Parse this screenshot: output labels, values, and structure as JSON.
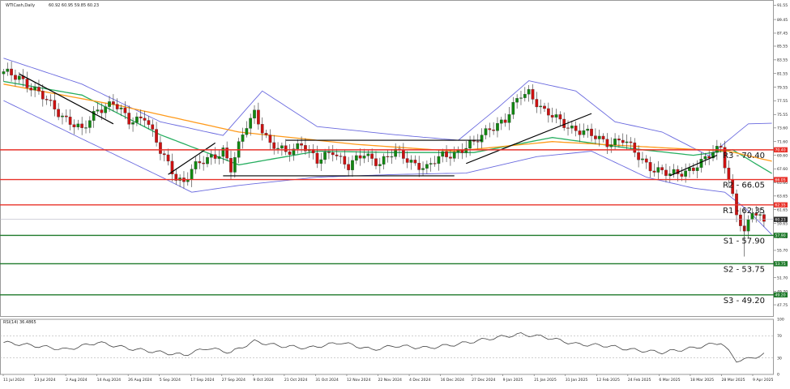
{
  "header": {
    "symbol": "WTICash,Daily",
    "ohlc": "60.92 60.95 59.85 60.23"
  },
  "colors": {
    "candle": "#cc1111",
    "candle_up": "#118811",
    "bollinger": "#6a6adf",
    "ma_fast": "#27ae60",
    "ma_slow": "#ff9a1a",
    "resistance": "#e8322a",
    "support": "#1f7a2b",
    "trendline": "#000000",
    "rsi": "#444444",
    "grid": "#c8c8c8"
  },
  "chart_data": [
    {
      "type": "line",
      "title": "WTICash,Daily",
      "ylim": [
        46.1,
        92.3
      ],
      "y_ticks": [
        "91.55",
        "89.45",
        "87.45",
        "85.55",
        "83.55",
        "81.55",
        "79.55",
        "77.55",
        "75.55",
        "73.60",
        "71.60",
        "69.60",
        "67.60",
        "65.60",
        "63.65",
        "61.65",
        "59.65",
        "57.65",
        "55.70",
        "53.70",
        "51.70",
        "49.70",
        "47.75"
      ],
      "x_labels": [
        "11 Jul 2024",
        "23 Jul 2024",
        "2 Aug 2024",
        "14 Aug 2024",
        "26 Aug 2024",
        "5 Sep 2024",
        "17 Sep 2024",
        "27 Sep 2024",
        "9 Oct 2024",
        "21 Oct 2024",
        "31 Oct 2024",
        "12 Nov 2024",
        "22 Nov 2024",
        "4 Dec 2024",
        "16 Dec 2024",
        "27 Dec 2024",
        "9 Jan 2025",
        "21 Jan 2025",
        "31 Jan 2025",
        "12 Feb 2025",
        "24 Feb 2025",
        "6 Mar 2025",
        "18 Mar 2025",
        "28 Mar 2025",
        "9 Apr 2025"
      ],
      "price_keyframes": [
        [
          0,
          81.5
        ],
        [
          4,
          81.2
        ],
        [
          8,
          79.0
        ],
        [
          12,
          77.0
        ],
        [
          16,
          75.0
        ],
        [
          20,
          73.0
        ],
        [
          24,
          76.5
        ],
        [
          28,
          77.2
        ],
        [
          32,
          74.5
        ],
        [
          36,
          75.5
        ],
        [
          40,
          70.0
        ],
        [
          44,
          66.5
        ],
        [
          46,
          65.8
        ],
        [
          48,
          67.5
        ],
        [
          52,
          69.0
        ],
        [
          56,
          70.5
        ],
        [
          58,
          67.5
        ],
        [
          62,
          74.0
        ],
        [
          64,
          76.0
        ],
        [
          68,
          71.0
        ],
        [
          72,
          70.0
        ],
        [
          76,
          71.5
        ],
        [
          80,
          68.5
        ],
        [
          84,
          70.5
        ],
        [
          88,
          67.8
        ],
        [
          92,
          69.8
        ],
        [
          96,
          68.6
        ],
        [
          100,
          70.0
        ],
        [
          104,
          68.8
        ],
        [
          108,
          67.6
        ],
        [
          112,
          69.6
        ],
        [
          116,
          70.2
        ],
        [
          120,
          71.2
        ],
        [
          124,
          73.8
        ],
        [
          128,
          74.6
        ],
        [
          132,
          78.5
        ],
        [
          134,
          79.0
        ],
        [
          138,
          75.8
        ],
        [
          142,
          74.6
        ],
        [
          146,
          73.4
        ],
        [
          150,
          72.4
        ],
        [
          154,
          71.6
        ],
        [
          158,
          71.8
        ],
        [
          162,
          69.4
        ],
        [
          166,
          67.6
        ],
        [
          170,
          66.6
        ],
        [
          174,
          67.4
        ],
        [
          178,
          68.4
        ],
        [
          182,
          70.4
        ],
        [
          183,
          71.0
        ],
        [
          185,
          66.2
        ],
        [
          187,
          61.2
        ],
        [
          189,
          57.8
        ],
        [
          191,
          61.4
        ],
        [
          193,
          60.6
        ],
        [
          194,
          60.2
        ]
      ],
      "series": [
        {
          "name": "",
          "kind": "bollinger_upper",
          "values": [
            [
              0,
              83.8
            ],
            [
              20,
              80.0
            ],
            [
              40,
              74.5
            ],
            [
              56,
              72.5
            ],
            [
              66,
              79.0
            ],
            [
              80,
              73.8
            ],
            [
              100,
              72.6
            ],
            [
              116,
              71.8
            ],
            [
              126,
              76.5
            ],
            [
              134,
              80.5
            ],
            [
              146,
              79.0
            ],
            [
              156,
              74.5
            ],
            [
              168,
              73.0
            ],
            [
              180,
              69.5
            ],
            [
              190,
              74.2
            ],
            [
              197,
              74.3
            ]
          ]
        },
        {
          "name": "",
          "kind": "bollinger_lower",
          "values": [
            [
              0,
              77.6
            ],
            [
              20,
              72.0
            ],
            [
              40,
              66.5
            ],
            [
              48,
              64.2
            ],
            [
              60,
              65.2
            ],
            [
              80,
              66.4
            ],
            [
              100,
              66.8
            ],
            [
              118,
              67.0
            ],
            [
              136,
              69.4
            ],
            [
              150,
              70.2
            ],
            [
              164,
              66.4
            ],
            [
              176,
              64.8
            ],
            [
              184,
              64.2
            ],
            [
              190,
              61.5
            ],
            [
              197,
              57.4
            ]
          ]
        },
        {
          "name": "",
          "kind": "ma_fast",
          "values": [
            [
              0,
              80.4
            ],
            [
              20,
              78.4
            ],
            [
              40,
              72.6
            ],
            [
              60,
              68.2
            ],
            [
              80,
              70.2
            ],
            [
              100,
              70.0
            ],
            [
              120,
              70.0
            ],
            [
              140,
              72.2
            ],
            [
              160,
              70.6
            ],
            [
              176,
              69.6
            ],
            [
              186,
              70.4
            ],
            [
              197,
              66.6
            ]
          ]
        },
        {
          "name": "",
          "kind": "ma_slow",
          "values": [
            [
              0,
              80.0
            ],
            [
              30,
              76.8
            ],
            [
              60,
              73.0
            ],
            [
              90,
              71.2
            ],
            [
              115,
              70.2
            ],
            [
              140,
              71.6
            ],
            [
              165,
              70.8
            ],
            [
              185,
              70.2
            ],
            [
              197,
              68.6
            ]
          ]
        }
      ],
      "levels": [
        {
          "label": "R3 - 70.40",
          "value": 70.4,
          "tag": "70.40",
          "kind": "resistance"
        },
        {
          "label": "R2 - 66.05",
          "value": 66.05,
          "tag": "66.05",
          "kind": "resistance"
        },
        {
          "label": "R1 - 62.35",
          "value": 62.35,
          "tag": "62.35",
          "kind": "resistance"
        },
        {
          "label": "S1 - 57.90",
          "value": 57.9,
          "tag": "57.90",
          "kind": "support"
        },
        {
          "label": "S2 - 53.75",
          "value": 53.75,
          "tag": "53.75",
          "kind": "support"
        },
        {
          "label": "S3 - 49.20",
          "value": 49.2,
          "tag": "49.20",
          "kind": "support"
        }
      ],
      "current_price": {
        "value": 60.23,
        "tag": "60.23"
      },
      "trendlines": [
        [
          [
            4,
            81.5
          ],
          [
            28,
            74.2
          ]
        ],
        [
          [
            42,
            66.8
          ],
          [
            54,
            71.4
          ]
        ],
        [
          [
            72,
            71.8
          ],
          [
            122,
            71.8
          ]
        ],
        [
          [
            56,
            66.6
          ],
          [
            115,
            66.6
          ]
        ],
        [
          [
            118,
            68.4
          ],
          [
            150,
            75.7
          ]
        ],
        [
          [
            170,
            66.6
          ],
          [
            182,
            69.6
          ]
        ]
      ]
    },
    {
      "type": "line",
      "title": "RSI(14) 36.4865",
      "ylim": [
        0,
        100
      ],
      "y_ticks": [
        "100",
        "70",
        "30",
        "0"
      ],
      "reference_levels": [
        30,
        70
      ],
      "series": [
        {
          "name": "",
          "values": [
            [
              0,
              58
            ],
            [
              8,
              52
            ],
            [
              16,
              45
            ],
            [
              24,
              58
            ],
            [
              32,
              47
            ],
            [
              40,
              40
            ],
            [
              46,
              35
            ],
            [
              52,
              48
            ],
            [
              58,
              40
            ],
            [
              64,
              60
            ],
            [
              70,
              52
            ],
            [
              78,
              48
            ],
            [
              86,
              58
            ],
            [
              94,
              45
            ],
            [
              100,
              52
            ],
            [
              108,
              48
            ],
            [
              116,
              55
            ],
            [
              124,
              65
            ],
            [
              132,
              73
            ],
            [
              138,
              68
            ],
            [
              146,
              55
            ],
            [
              154,
              52
            ],
            [
              160,
              45
            ],
            [
              168,
              40
            ],
            [
              176,
              48
            ],
            [
              183,
              58
            ],
            [
              187,
              25
            ],
            [
              190,
              28
            ],
            [
              194,
              36.5
            ]
          ]
        }
      ]
    }
  ]
}
